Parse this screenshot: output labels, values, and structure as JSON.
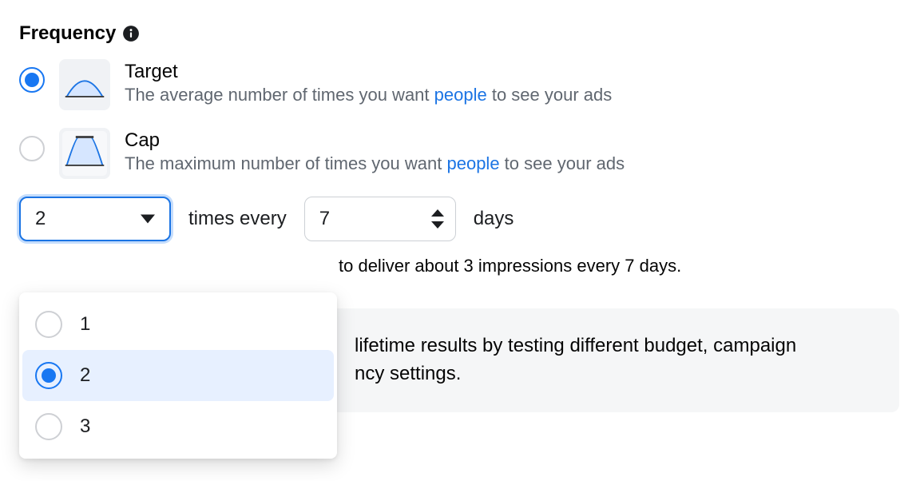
{
  "section": {
    "title": "Frequency"
  },
  "options": {
    "target": {
      "label": "Target",
      "desc_pre": "The average number of times you want ",
      "link": "people",
      "desc_post": " to see your ads"
    },
    "cap": {
      "label": "Cap",
      "desc_pre": "The maximum number of times you want ",
      "link": "people",
      "desc_post": " to see your ads"
    }
  },
  "controls": {
    "select_value": "2",
    "label_times_every": "times every",
    "number_value": "7",
    "label_days": "days"
  },
  "hint_tail": "to deliver about 3 impressions every 7 days.",
  "tip_line1_tail": "lifetime results by testing different budget, campaign",
  "tip_line2_tail": "ncy settings.",
  "dropdown": {
    "items": [
      {
        "label": "1"
      },
      {
        "label": "2"
      },
      {
        "label": "3"
      }
    ]
  }
}
